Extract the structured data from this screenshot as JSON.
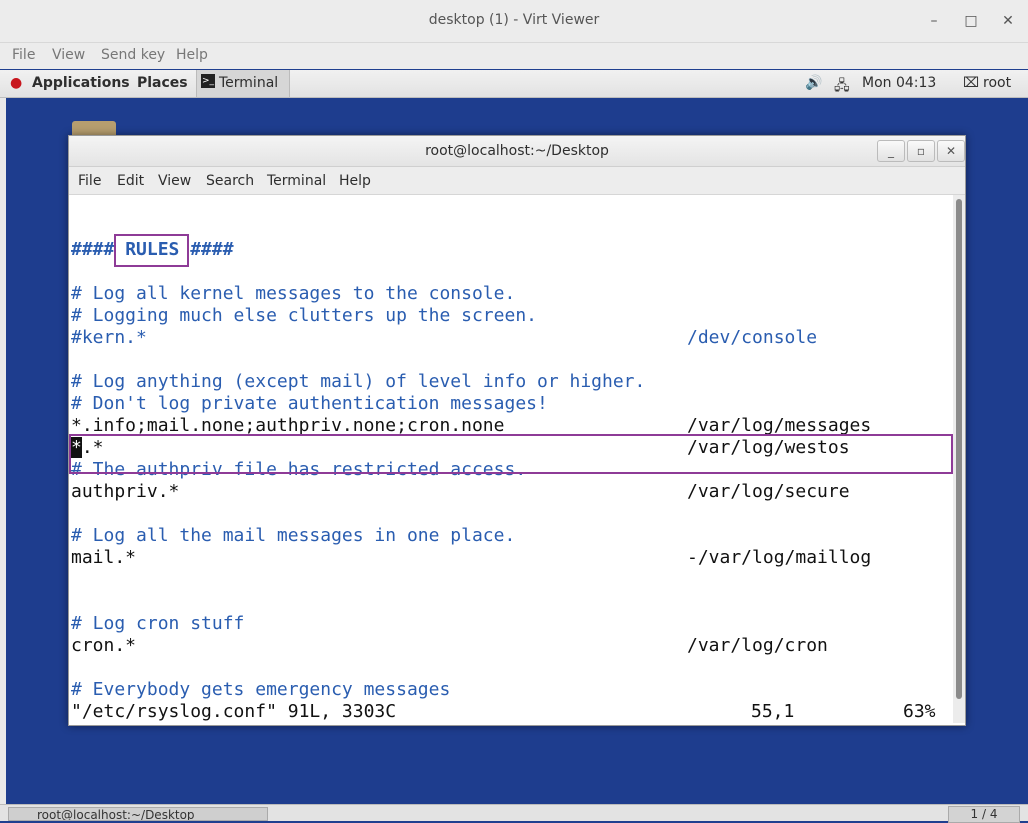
{
  "viewer": {
    "title": "desktop (1) - Virt Viewer",
    "controls": {
      "minimize": "–",
      "maximize": "□",
      "close": "✕"
    },
    "menu": [
      "File",
      "View",
      "Send key",
      "Help"
    ]
  },
  "gnome_panel": {
    "applications": "Applications",
    "places": "Places",
    "terminal_task": "Terminal",
    "clock": "Mon 04:13",
    "user": "root",
    "icons": [
      "volume-icon",
      "network-icon",
      "user-icon"
    ]
  },
  "terminal": {
    "title": "root@localhost:~/Desktop",
    "menu": [
      "File",
      "Edit",
      "View",
      "Search",
      "Terminal",
      "Help"
    ],
    "lines": {
      "rules_pre": "####",
      "rules_word": " RULES ",
      "rules_post": "####",
      "c1": "# Log all kernel messages to the console.",
      "c2": "# Logging much else clutters up the screen.",
      "kern": "#kern.*",
      "kern_path": "/dev/console",
      "c3": "# Log anything (except mail) of level info or higher.",
      "c4": "# Don't log private authentication messages!",
      "info": "*.info;mail.none;authpriv.none;cron.none",
      "info_path": "/var/log/messages",
      "star_cursor": "*",
      "star_rest": ".*",
      "star_path": "/var/log/westos",
      "c5": "# The authpriv file has restricted access.",
      "authpriv": "authpriv.*",
      "authpriv_path": "/var/log/secure",
      "c6": "# Log all the mail messages in one place.",
      "mail": "mail.*",
      "mail_path": "-/var/log/maillog",
      "c7": "# Log cron stuff",
      "cron": "cron.*",
      "cron_path": "/var/log/cron",
      "c8": "# Everybody gets emergency messages"
    },
    "status": {
      "file": "\"/etc/rsyslog.conf\" 91L, 3303C",
      "position": "55,1",
      "percent": "63%"
    }
  },
  "bottom_bar": {
    "task": "root@localhost:~/Desktop",
    "workspace": "1 / 4"
  },
  "colors": {
    "highlight_box": "#8e3b97",
    "comment": "#2a5db0",
    "desktop": "#1e3d8e"
  }
}
